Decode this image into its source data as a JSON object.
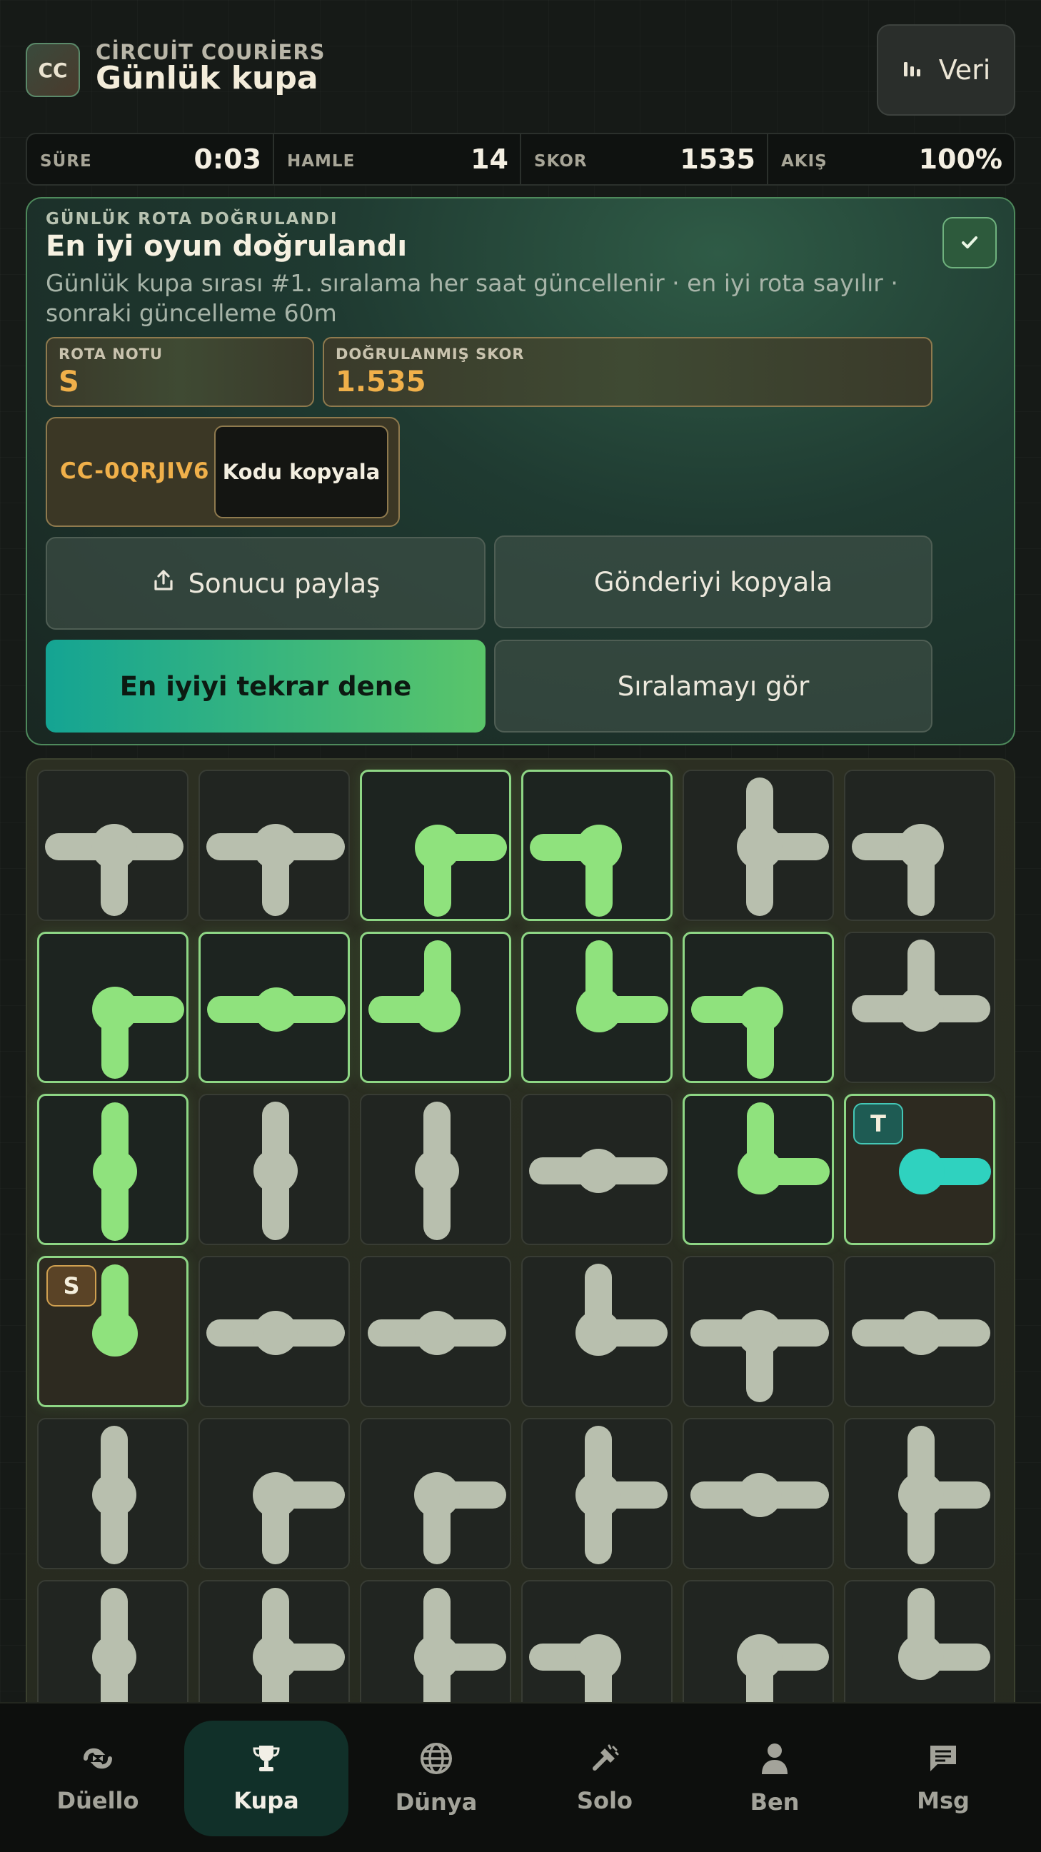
{
  "header": {
    "logo": "CC",
    "brand": "CİRCUİT COURİERS",
    "title": "Günlük kupa",
    "data_button": "Veri"
  },
  "stats": [
    {
      "label": "SÜRE",
      "value": "0:03"
    },
    {
      "label": "HAMLE",
      "value": "14"
    },
    {
      "label": "SKOR",
      "value": "1535"
    },
    {
      "label": "AKIŞ",
      "value": "100%"
    }
  ],
  "result": {
    "kicker": "GÜNLÜK ROTA DOĞRULANDI",
    "headline": "En iyi oyun doğrulandı",
    "description": "Günlük kupa sırası #1. sıralama her saat güncellenir · en iyi rota sayılır · sonraki güncelleme 60m",
    "grade_label": "ROTA NOTU",
    "grade_value": "S",
    "score_label": "DOĞRULANMIŞ SKOR",
    "score_value": "1.535",
    "code": "CC-0QRJIV6",
    "copy_code": "Kodu kopyala",
    "share": "Sonucu paylaş",
    "copy_post": "Gönderiyi kopyala",
    "retry": "En iyiyi tekrar dene",
    "leaderboard": "Sıralamayı gör"
  },
  "board": {
    "start_badge": "S",
    "target_badge": "T",
    "rows": [
      [
        {
          "c": "LRD",
          "on": false
        },
        {
          "c": "LRD",
          "on": false
        },
        {
          "c": "RD",
          "on": true
        },
        {
          "c": "LD",
          "on": true
        },
        {
          "c": "URD",
          "on": false
        },
        {
          "c": "LD",
          "on": false
        }
      ],
      [
        {
          "c": "RD",
          "on": true
        },
        {
          "c": "LR",
          "on": true
        },
        {
          "c": "UL",
          "on": true
        },
        {
          "c": "UR",
          "on": true
        },
        {
          "c": "LD",
          "on": true
        },
        {
          "c": "ULR",
          "on": false
        }
      ],
      [
        {
          "c": "UD",
          "on": true
        },
        {
          "c": "UD",
          "on": false
        },
        {
          "c": "UD",
          "on": false
        },
        {
          "c": "LR",
          "on": false
        },
        {
          "c": "UR",
          "on": true
        },
        {
          "c": "R",
          "on": true,
          "special": "T"
        }
      ],
      [
        {
          "c": "U",
          "on": true,
          "special": "S"
        },
        {
          "c": "LR",
          "on": false
        },
        {
          "c": "LR",
          "on": false
        },
        {
          "c": "UR",
          "on": false
        },
        {
          "c": "LRD",
          "on": false
        },
        {
          "c": "LR",
          "on": false
        }
      ],
      [
        {
          "c": "UD",
          "on": false
        },
        {
          "c": "RD",
          "on": false
        },
        {
          "c": "RD",
          "on": false
        },
        {
          "c": "URD",
          "on": false
        },
        {
          "c": "LR",
          "on": false
        },
        {
          "c": "URD",
          "on": false
        }
      ],
      [
        {
          "c": "UD",
          "on": false
        },
        {
          "c": "URD",
          "on": false
        },
        {
          "c": "URD",
          "on": false
        },
        {
          "c": "LD",
          "on": false
        },
        {
          "c": "RD",
          "on": false
        },
        {
          "c": "UR",
          "on": false
        }
      ]
    ]
  },
  "colors": {
    "pipe_on": "#8fe27d",
    "pipe_off": "#b8bfae",
    "pipe_target": "#2fd2bf"
  },
  "nav": [
    {
      "label": "Düello",
      "icon": "duel-icon",
      "active": false
    },
    {
      "label": "Kupa",
      "icon": "trophy-icon",
      "active": true
    },
    {
      "label": "Dünya",
      "icon": "globe-icon",
      "active": false
    },
    {
      "label": "Solo",
      "icon": "tools-icon",
      "active": false
    },
    {
      "label": "Ben",
      "icon": "person-icon",
      "active": false
    },
    {
      "label": "Msg",
      "icon": "message-icon",
      "active": false
    }
  ]
}
